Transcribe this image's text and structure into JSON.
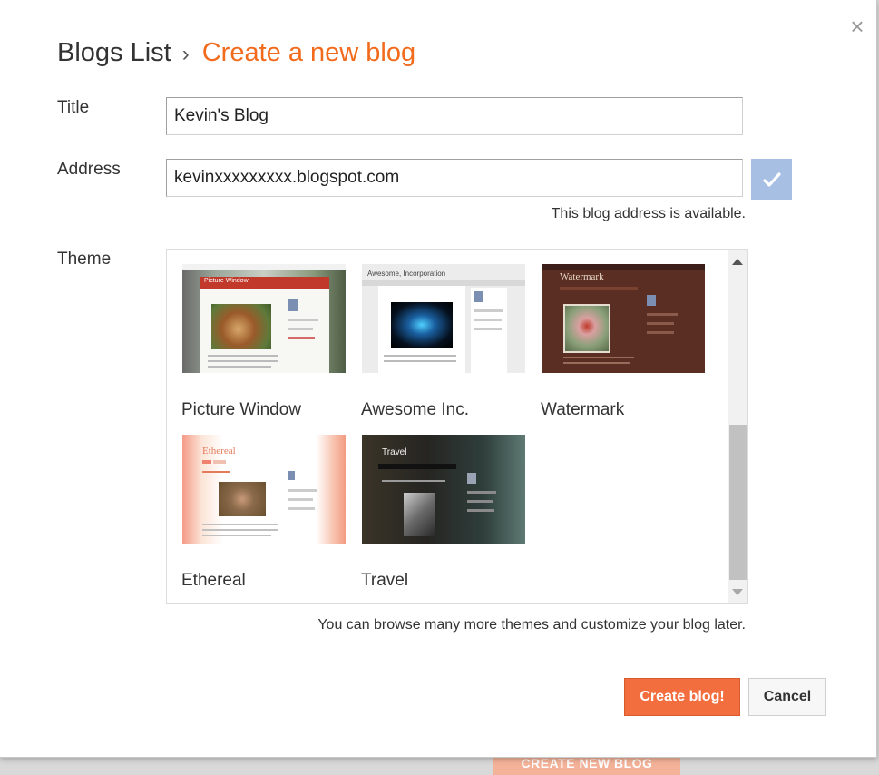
{
  "breadcrumb": {
    "parent": "Blogs List",
    "separator": "›",
    "current": "Create a new blog"
  },
  "form": {
    "title_label": "Title",
    "title_value": "Kevin's Blog",
    "address_label": "Address",
    "address_value": "kevinxxxxxxxxx.blogspot.com",
    "address_status": "This blog address is available.",
    "theme_label": "Theme"
  },
  "themes": [
    {
      "name": "Picture Window",
      "thumb_title": "Picture Window"
    },
    {
      "name": "Awesome Inc.",
      "thumb_title": "Awesome, Incorporation"
    },
    {
      "name": "Watermark",
      "thumb_title": "Watermark"
    },
    {
      "name": "Ethereal",
      "thumb_title": "Ethereal"
    },
    {
      "name": "Travel",
      "thumb_title": "Travel"
    }
  ],
  "theme_hint": "You can browse many more themes and customize your blog later.",
  "buttons": {
    "create": "Create blog!",
    "cancel": "Cancel",
    "close": "×"
  },
  "backdrop": {
    "button": "CREATE NEW BLOG"
  },
  "colors": {
    "accent": "#f26a1b",
    "create_button": "#f36e3f",
    "check_button": "#a8bfe4"
  }
}
